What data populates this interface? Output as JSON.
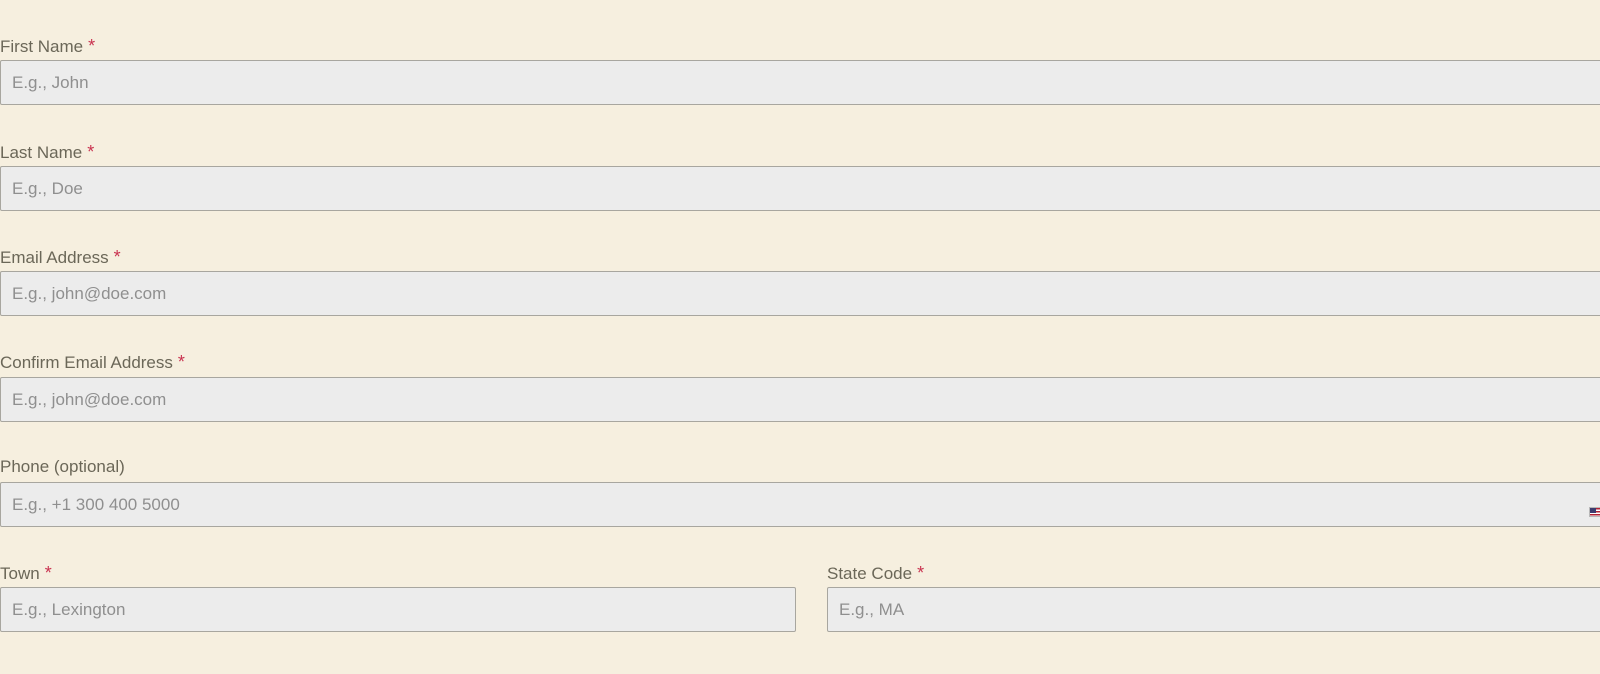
{
  "required_marker": "*",
  "form": {
    "first_name": {
      "label": "First Name",
      "placeholder": "E.g., John"
    },
    "last_name": {
      "label": "Last Name",
      "placeholder": "E.g., Doe"
    },
    "email": {
      "label": "Email Address",
      "placeholder": "E.g., john@doe.com"
    },
    "confirm_email": {
      "label": "Confirm Email Address",
      "placeholder": "E.g., john@doe.com"
    },
    "phone": {
      "label": "Phone (optional)",
      "placeholder": "E.g., +1 300 400 5000",
      "country_flag_icon": "us-flag-icon"
    },
    "town": {
      "label": "Town",
      "placeholder": "E.g., Lexington"
    },
    "state_code": {
      "label": "State Code",
      "placeholder": "E.g., MA"
    }
  },
  "colors": {
    "background": "#f6efdf",
    "input_background": "#ececec",
    "label": "#6b6758",
    "required": "#c9324f",
    "placeholder": "#8f8f8f",
    "input_border": "#a8a69f"
  }
}
